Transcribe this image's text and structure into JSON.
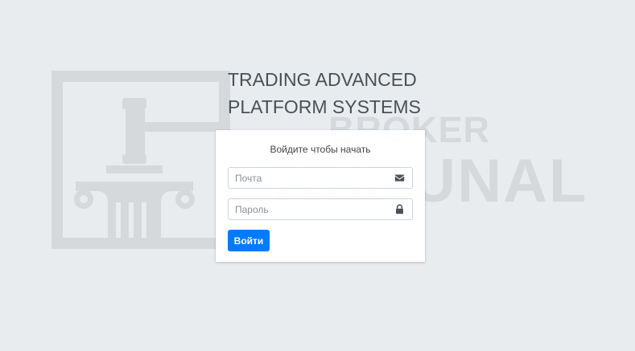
{
  "page": {
    "title_line1": "TRADING ADVANCED",
    "title_line2": "PLATFORM SYSTEMS"
  },
  "watermark": {
    "brand_top": "BROKER",
    "brand_bottom": "TRIBUNAL",
    "logo_icon": "gavel-column-icon"
  },
  "login": {
    "message": "Войдите чтобы начать",
    "email_placeholder": "Почта",
    "email_icon": "envelope-icon",
    "password_placeholder": "Пароль",
    "password_icon": "lock-icon",
    "submit_label": "Войти"
  },
  "colors": {
    "background": "#e9ecef",
    "primary": "#007bff",
    "title": "#495057",
    "watermark": "#d6d9dc"
  }
}
